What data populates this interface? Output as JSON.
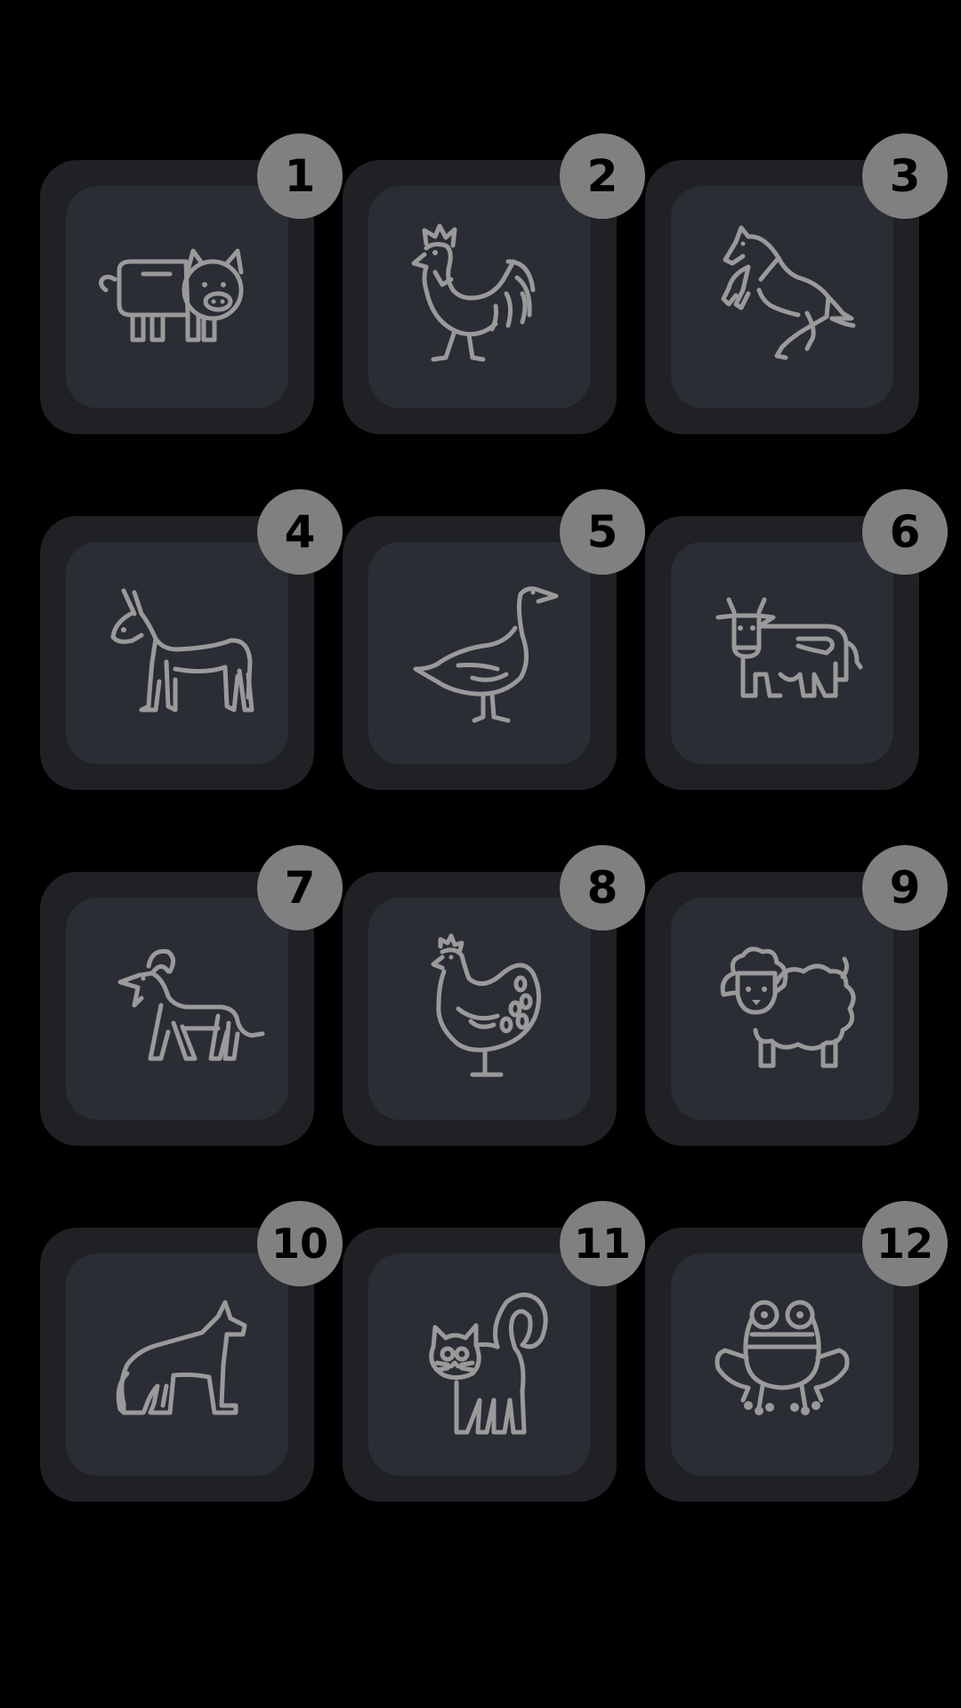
{
  "tiles": [
    {
      "number": "1",
      "icon": "pig-icon"
    },
    {
      "number": "2",
      "icon": "rooster-icon"
    },
    {
      "number": "3",
      "icon": "horse-icon"
    },
    {
      "number": "4",
      "icon": "donkey-icon"
    },
    {
      "number": "5",
      "icon": "goose-icon"
    },
    {
      "number": "6",
      "icon": "cow-icon"
    },
    {
      "number": "7",
      "icon": "goat-icon"
    },
    {
      "number": "8",
      "icon": "hen-icon"
    },
    {
      "number": "9",
      "icon": "sheep-icon"
    },
    {
      "number": "10",
      "icon": "dog-icon"
    },
    {
      "number": "11",
      "icon": "cat-icon"
    },
    {
      "number": "12",
      "icon": "frog-icon"
    }
  ],
  "colors": {
    "background": "#000000",
    "tile_outer": "#1f2124",
    "tile_inner": "#2a2d33",
    "icon_stroke": "#9a9a9a",
    "badge": "#808080",
    "badge_text": "#000000"
  }
}
